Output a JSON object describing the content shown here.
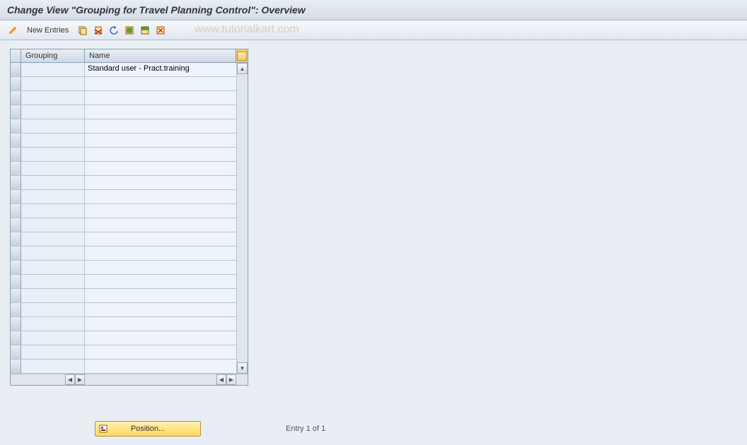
{
  "header": {
    "title": "Change View \"Grouping for Travel Planning Control\": Overview"
  },
  "toolbar": {
    "new_entries_label": "New Entries"
  },
  "table": {
    "headers": {
      "grouping": "Grouping",
      "name": "Name"
    },
    "rows": [
      {
        "grouping": "",
        "name": "Standard user - Pract.training"
      },
      {
        "grouping": "",
        "name": ""
      },
      {
        "grouping": "",
        "name": ""
      },
      {
        "grouping": "",
        "name": ""
      },
      {
        "grouping": "",
        "name": ""
      },
      {
        "grouping": "",
        "name": ""
      },
      {
        "grouping": "",
        "name": ""
      },
      {
        "grouping": "",
        "name": ""
      },
      {
        "grouping": "",
        "name": ""
      },
      {
        "grouping": "",
        "name": ""
      },
      {
        "grouping": "",
        "name": ""
      },
      {
        "grouping": "",
        "name": ""
      },
      {
        "grouping": "",
        "name": ""
      },
      {
        "grouping": "",
        "name": ""
      },
      {
        "grouping": "",
        "name": ""
      },
      {
        "grouping": "",
        "name": ""
      },
      {
        "grouping": "",
        "name": ""
      },
      {
        "grouping": "",
        "name": ""
      },
      {
        "grouping": "",
        "name": ""
      },
      {
        "grouping": "",
        "name": ""
      },
      {
        "grouping": "",
        "name": ""
      },
      {
        "grouping": "",
        "name": ""
      }
    ]
  },
  "footer": {
    "position_label": "Position...",
    "entry_text": "Entry 1 of 1"
  },
  "watermark": "www.tutorialkart.com"
}
